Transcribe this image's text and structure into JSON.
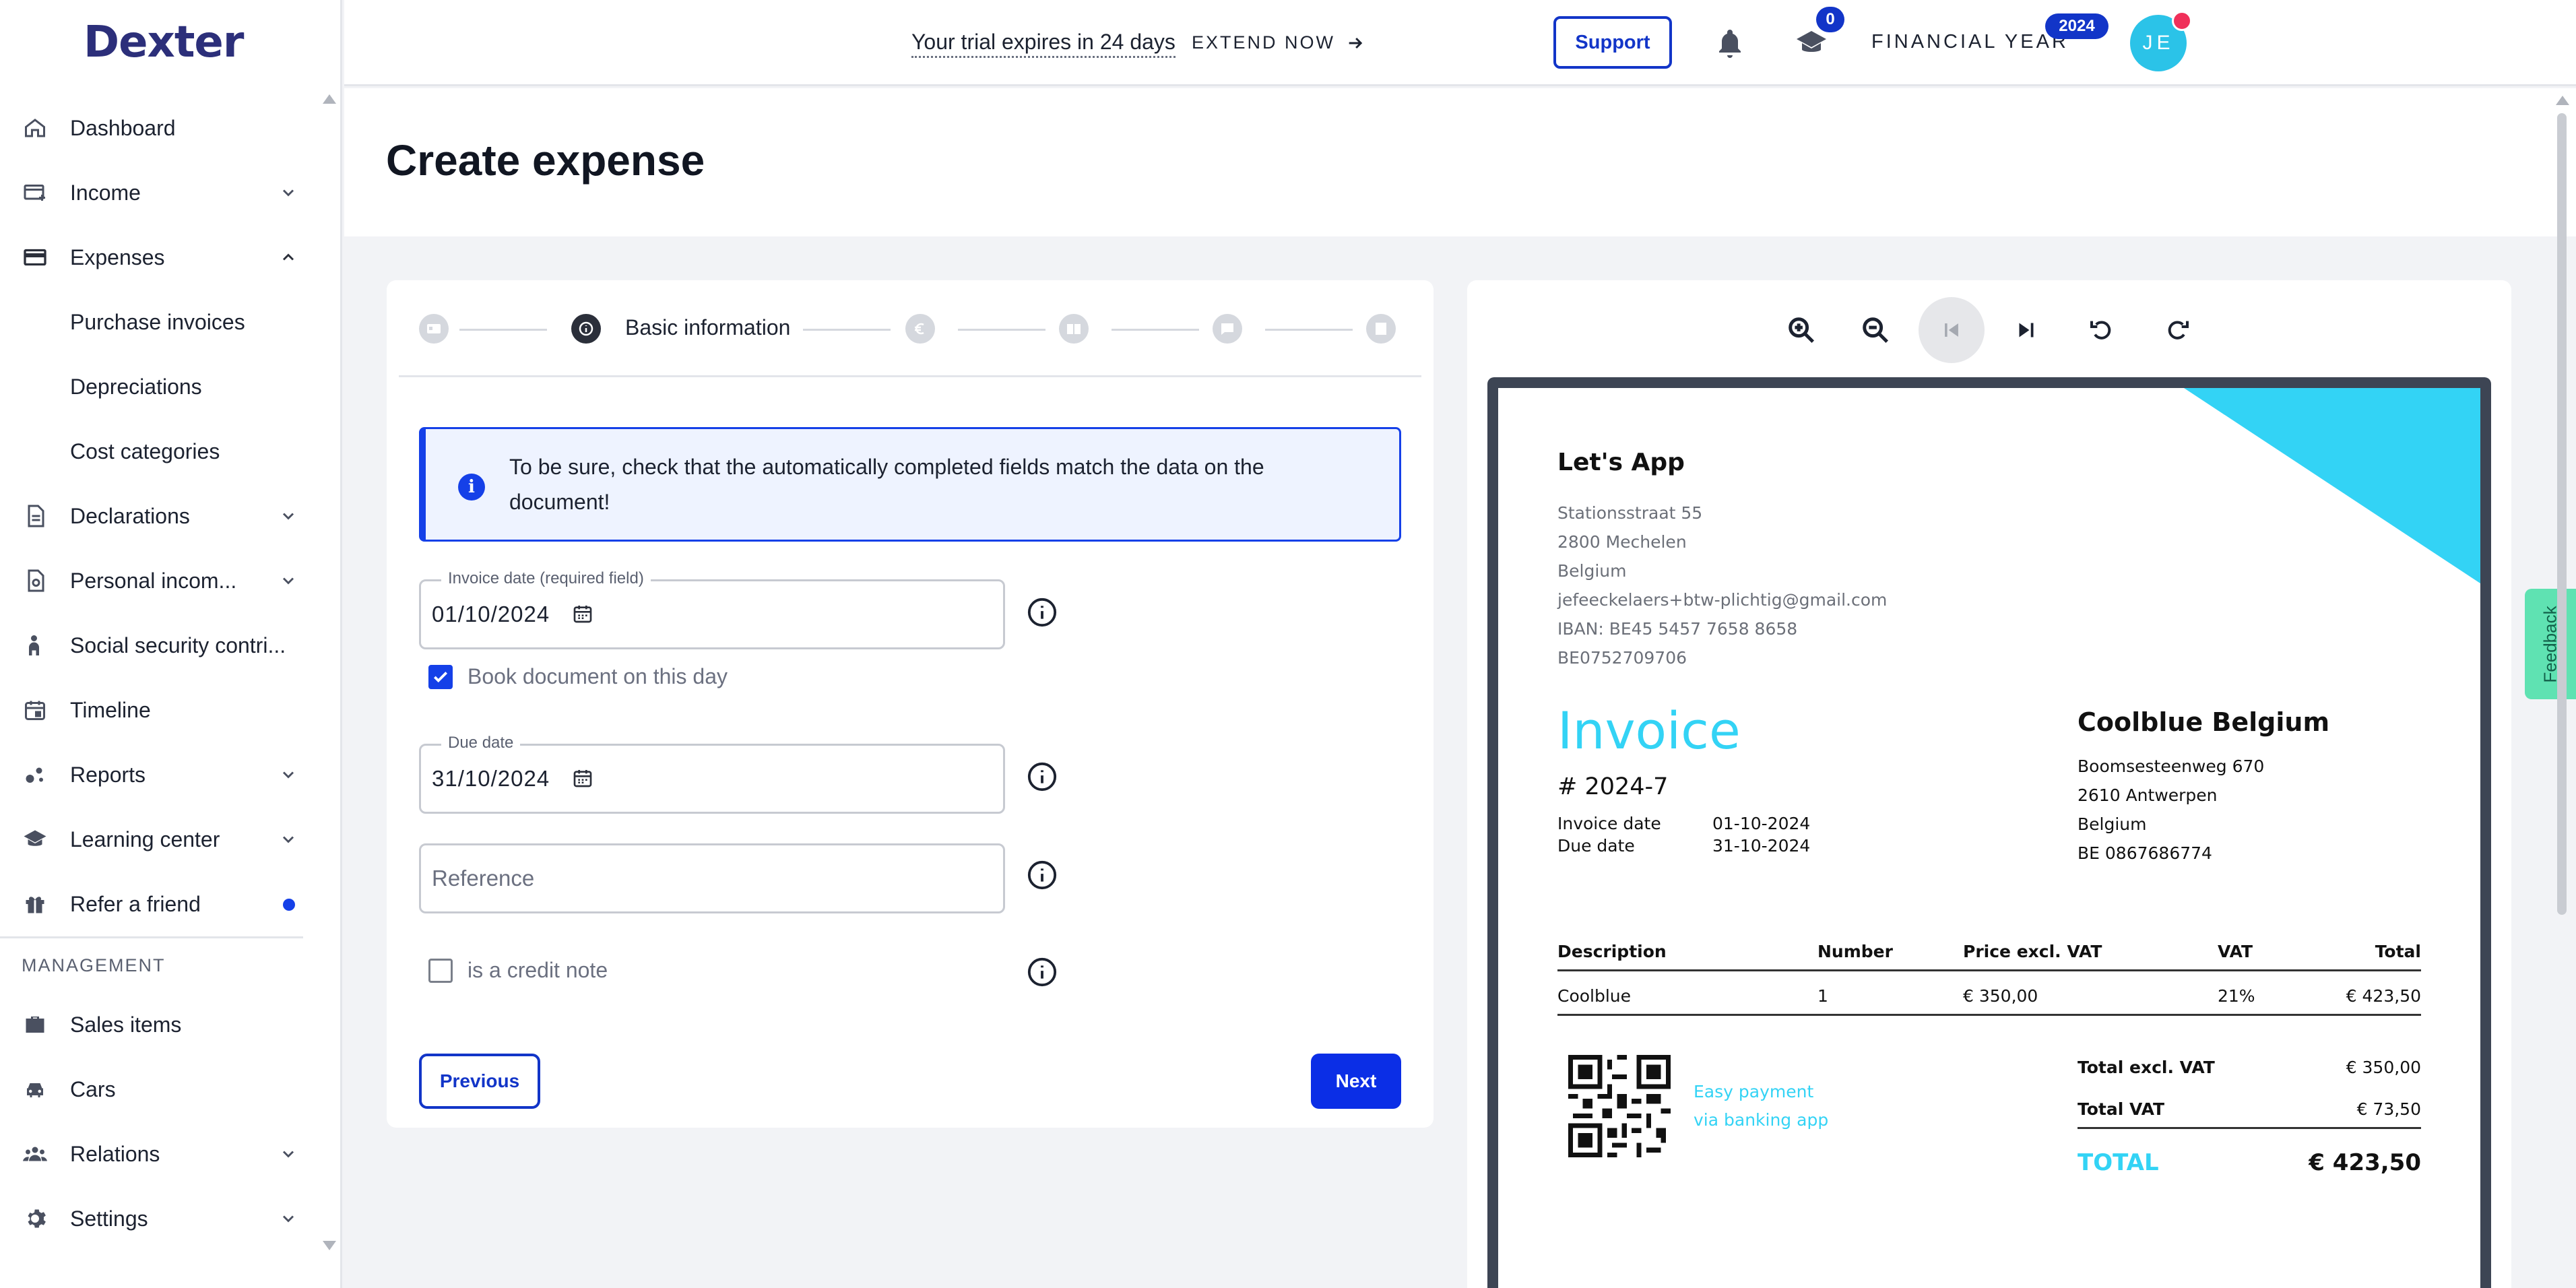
{
  "app": {
    "logo": "Dexter"
  },
  "sidebar": {
    "items": [
      {
        "label": "Dashboard",
        "icon": "home-icon"
      },
      {
        "label": "Income",
        "icon": "income-icon",
        "expandable": true
      },
      {
        "label": "Expenses",
        "icon": "expenses-icon",
        "expanded": true,
        "children": [
          "Purchase invoices",
          "Depreciations",
          "Cost categories"
        ]
      },
      {
        "label": "Declarations",
        "icon": "declarations-icon",
        "expandable": true
      },
      {
        "label": "Personal incom...",
        "icon": "personal-income-icon",
        "expandable": true
      },
      {
        "label": "Social security contri...",
        "icon": "social-security-icon"
      },
      {
        "label": "Timeline",
        "icon": "calendar-icon"
      },
      {
        "label": "Reports",
        "icon": "reports-icon",
        "expandable": true
      },
      {
        "label": "Learning center",
        "icon": "graduation-cap-icon",
        "expandable": true
      },
      {
        "label": "Refer a friend",
        "icon": "gift-icon",
        "dot": true
      }
    ],
    "section_label": "MANAGEMENT",
    "management": [
      {
        "label": "Sales items",
        "icon": "briefcase-icon"
      },
      {
        "label": "Cars",
        "icon": "car-icon"
      },
      {
        "label": "Relations",
        "icon": "people-icon",
        "expandable": true
      },
      {
        "label": "Settings",
        "icon": "gear-icon",
        "expandable": true
      }
    ]
  },
  "topbar": {
    "trial_text": "Your trial expires in 24 days",
    "extend_label": "EXTEND NOW",
    "support_label": "Support",
    "learning_badge": "0",
    "financial_year_label": "FINANCIAL YEAR",
    "financial_year_badge": "2024",
    "avatar_initials": "JE"
  },
  "page": {
    "title": "Create expense"
  },
  "stepper": {
    "active_label": "Basic information"
  },
  "alert": {
    "text": "To be sure, check that the automatically completed fields match the data on the document!"
  },
  "form": {
    "invoice_date_label": "Invoice date (required field)",
    "invoice_date_value": "01/10/2024",
    "book_on_day_label": "Book document on this day",
    "book_on_day_checked": true,
    "due_date_label": "Due date",
    "due_date_value": "31/10/2024",
    "reference_placeholder": "Reference",
    "credit_note_label": "is a credit note",
    "credit_note_checked": false,
    "previous_label": "Previous",
    "next_label": "Next"
  },
  "preview": {
    "sender_name": "Let's App",
    "sender_address": [
      "Stationsstraat 55",
      "2800 Mechelen",
      "Belgium",
      "jefeeckelaers+btw-plichtig@gmail.com",
      "IBAN: BE45 5457 7658 8658",
      "BE0752709706"
    ],
    "doc_title": "Invoice",
    "doc_number": "# 2024-7",
    "invoice_date_key": "Invoice date",
    "invoice_date_val": "01-10-2024",
    "due_date_key": "Due date",
    "due_date_val": "31-10-2024",
    "client_name": "Coolblue Belgium",
    "client_address": [
      "Boomsesteenweg 670",
      "2610 Antwerpen",
      "Belgium",
      "BE 0867686774"
    ],
    "table_headers": [
      "Description",
      "Number",
      "Price excl. VAT",
      "VAT",
      "Total"
    ],
    "table_rows": [
      [
        "Coolblue",
        "1",
        "€ 350,00",
        "21%",
        "€ 423,50"
      ]
    ],
    "easy_payment": [
      "Easy payment",
      "via banking app"
    ],
    "totals": [
      {
        "k": "Total excl. VAT",
        "v": "€ 350,00"
      },
      {
        "k": "Total VAT",
        "v": "€ 73,50"
      }
    ],
    "grand_total_key": "TOTAL",
    "grand_total_val": "€ 423,50",
    "accent_color": "#33d3f5"
  },
  "feedback_label": "Feedback"
}
